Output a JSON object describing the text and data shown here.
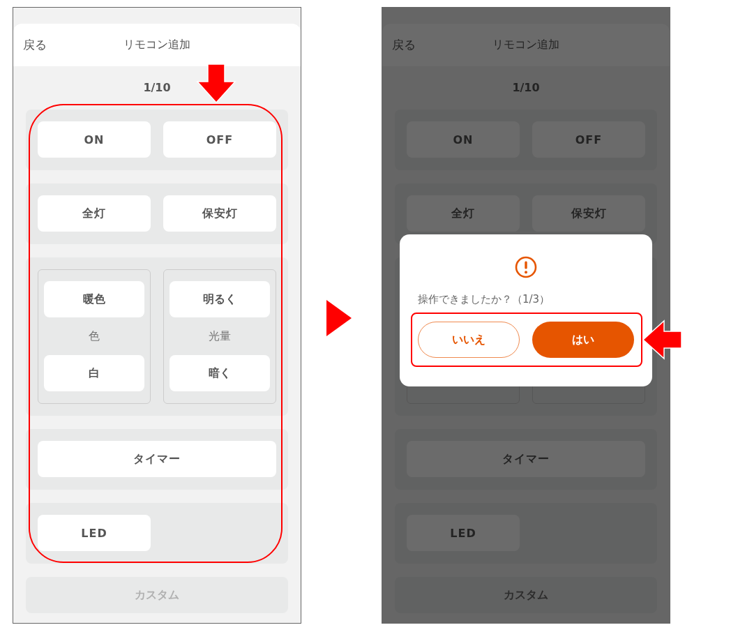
{
  "screens": [
    {
      "header": {
        "back": "戻る",
        "title": "リモコン追加"
      },
      "page": "1/10",
      "dimmed": false,
      "groups_highlighted": true,
      "groups": [
        {
          "kind": "pair",
          "buttons": [
            "ON",
            "OFF"
          ]
        },
        {
          "kind": "pair",
          "buttons": [
            "全灯",
            "保安灯"
          ]
        },
        {
          "kind": "dual",
          "panels": [
            {
              "buttons": [
                "暖色",
                "白"
              ],
              "label": "色"
            },
            {
              "buttons": [
                "明るく",
                "暗く"
              ],
              "label": "光量"
            }
          ]
        },
        {
          "kind": "wide",
          "buttons": [
            "タイマー"
          ]
        },
        {
          "kind": "half",
          "buttons": [
            "LED"
          ]
        }
      ],
      "custom": {
        "label": "カスタム",
        "disabled": true
      }
    },
    {
      "header": {
        "back": "戻る",
        "title": "リモコン追加"
      },
      "page": "1/10",
      "dimmed": true,
      "groups_highlighted": false,
      "groups": [
        {
          "kind": "pair",
          "buttons": [
            "ON",
            "OFF"
          ]
        },
        {
          "kind": "pair",
          "buttons": [
            "全灯",
            "保安灯"
          ]
        },
        {
          "kind": "covered"
        },
        {
          "kind": "wide",
          "buttons": [
            "タイマー"
          ]
        },
        {
          "kind": "half",
          "buttons": [
            "LED"
          ]
        }
      ],
      "custom": {
        "label": "カスタム",
        "disabled": true
      },
      "dialog": {
        "message": "操作できましたか？（1/3）",
        "buttons_highlighted": true,
        "buttons": [
          {
            "label": "いいえ",
            "kind": "outline"
          },
          {
            "label": "はい",
            "kind": "filled"
          }
        ]
      }
    }
  ]
}
